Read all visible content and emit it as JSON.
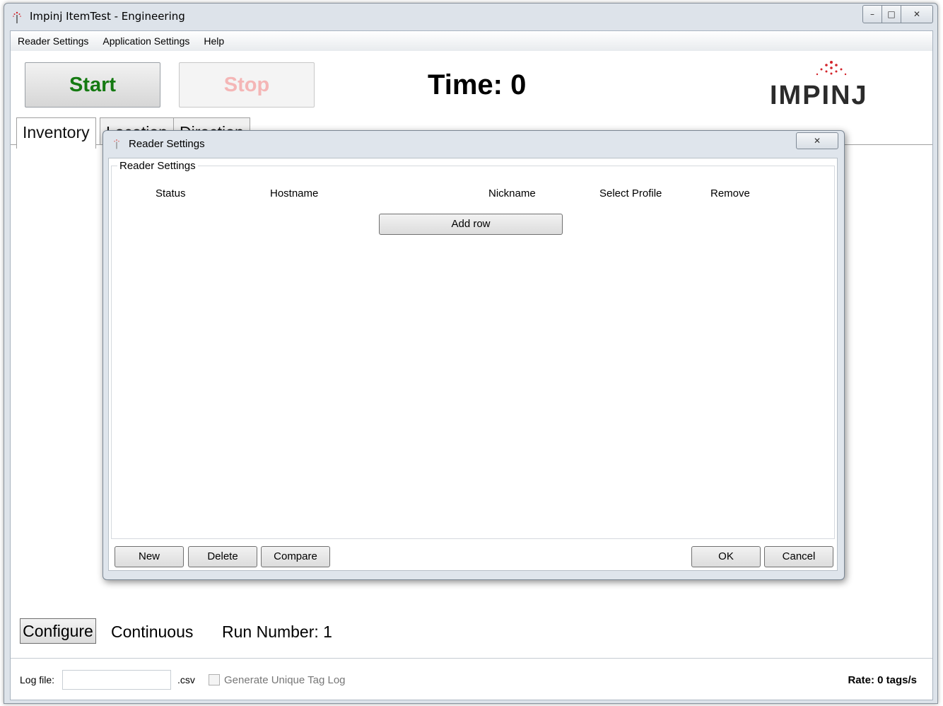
{
  "window": {
    "title": "Impinj ItemTest - Engineering",
    "controls": {
      "minimize": "–",
      "maximize": "□",
      "close": "✕"
    }
  },
  "menu": {
    "items": [
      "Reader Settings",
      "Application Settings",
      "Help"
    ]
  },
  "toolbar": {
    "start_label": "Start",
    "stop_label": "Stop",
    "time_label": "Time: 0",
    "logo_text": "IMPINJ"
  },
  "tabs": [
    {
      "label": "Inventory",
      "active": true
    },
    {
      "label": "Location",
      "active": false
    },
    {
      "label": "Direction",
      "active": false
    }
  ],
  "bottom": {
    "configure_label": "Configure",
    "mode_label": "Continuous",
    "run_number_label": "Run Number: 1"
  },
  "status": {
    "log_file_label": "Log file:",
    "log_file_value": "",
    "csv_label": ".csv",
    "unique_log_label": "Generate Unique Tag Log",
    "unique_log_checked": false,
    "rate_label": "Rate: 0 tags/s"
  },
  "dialog": {
    "title": "Reader Settings",
    "close": "✕",
    "group_title": "Reader Settings",
    "columns": [
      "Status",
      "Hostname",
      "Nickname",
      "Select Profile",
      "Remove"
    ],
    "add_row_label": "Add row",
    "buttons": {
      "new": "New",
      "delete": "Delete",
      "compare": "Compare",
      "ok": "OK",
      "cancel": "Cancel"
    }
  },
  "colors": {
    "start_text": "#157a12",
    "stop_text_disabled": "#f4b6b6",
    "logo_dots": "#d2232a"
  }
}
